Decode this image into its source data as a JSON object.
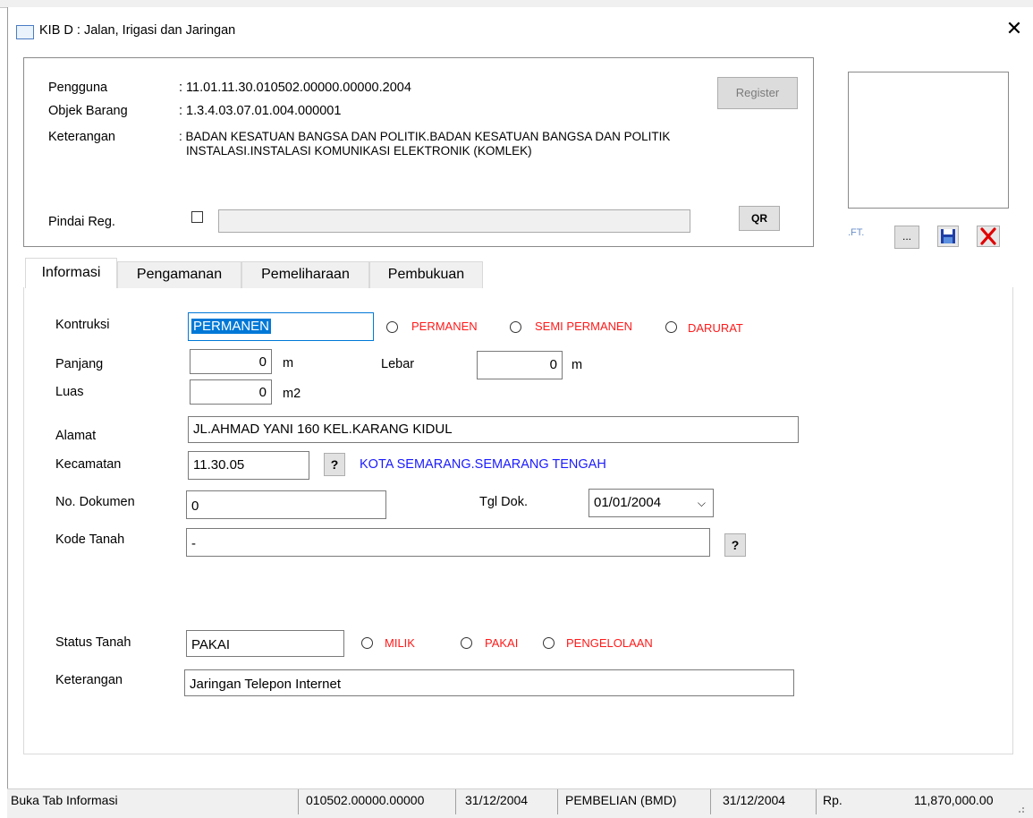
{
  "window": {
    "title": "KIB D : Jalan, Irigasi dan Jaringan"
  },
  "header": {
    "rows": [
      {
        "label": "Pengguna",
        "value": ": 11.01.11.30.010502.00000.00000.2004"
      },
      {
        "label": "Objek Barang",
        "value": ": 1.3.4.03.07.01.004.000001"
      },
      {
        "label": "Keterangan",
        "value": ": BADAN  KESATUAN  BANGSA  DAN  POLITIK.BADAN KESATUAN BANGSA DAN POLITIK",
        "value2": "INSTALASI.INSTALASI KOMUNIKASI ELEKTRONIK (KOMLEK)"
      }
    ],
    "register_label": "Register",
    "pindai_label": "Pindai Reg.",
    "pindai_value": "",
    "qr_label": "QR"
  },
  "photo": {
    "ft_label": ".FT.",
    "browse_label": "...",
    "save_icon": "floppy-icon",
    "delete_icon": "red-x-icon"
  },
  "tabs": [
    {
      "label": "Informasi"
    },
    {
      "label": "Pengamanan"
    },
    {
      "label": "Pemeliharaan"
    },
    {
      "label": "Pembukuan"
    }
  ],
  "form": {
    "kontruksi": {
      "label": "Kontruksi",
      "value": "PERMANEN",
      "options": [
        "PERMANEN",
        "SEMI PERMANEN",
        "DARURAT"
      ]
    },
    "panjang": {
      "label": "Panjang",
      "value": "0",
      "unit": "m"
    },
    "lebar": {
      "label": "Lebar",
      "value": "0",
      "unit": "m"
    },
    "luas": {
      "label": "Luas",
      "value": "0",
      "unit": "m2"
    },
    "alamat": {
      "label": "Alamat",
      "value": "JL.AHMAD YANI 160 KEL.KARANG KIDUL"
    },
    "kecamatan": {
      "label": "Kecamatan",
      "value": "11.30.05",
      "lookup": "?",
      "name": "KOTA SEMARANG.SEMARANG TENGAH"
    },
    "no_dokumen": {
      "label": "No. Dokumen",
      "value": "0"
    },
    "tgl_dok": {
      "label": "Tgl Dok.",
      "value": "01/01/2004",
      "chevron": "⌵"
    },
    "kode_tanah": {
      "label": "Kode Tanah",
      "value": "-",
      "lookup": "?"
    },
    "status_tanah": {
      "label": "Status Tanah",
      "value": "PAKAI",
      "options": [
        "MILIK",
        "PAKAI",
        "PENGELOLAAN"
      ]
    },
    "keterangan": {
      "label": "Keterangan",
      "value": "Jaringan Telepon Internet"
    }
  },
  "statusbar": {
    "message": "Buka Tab Informasi",
    "code": "010502.00000.00000",
    "date1": "31/12/2004",
    "acquisition": "PEMBELIAN (BMD)",
    "date2": "31/12/2004",
    "currency": "Rp.",
    "amount": "11,870,000.00"
  },
  "colors": {
    "accent_red": "#ff1a1a",
    "link_blue": "#1a1aff",
    "selection": "#0078d7"
  }
}
